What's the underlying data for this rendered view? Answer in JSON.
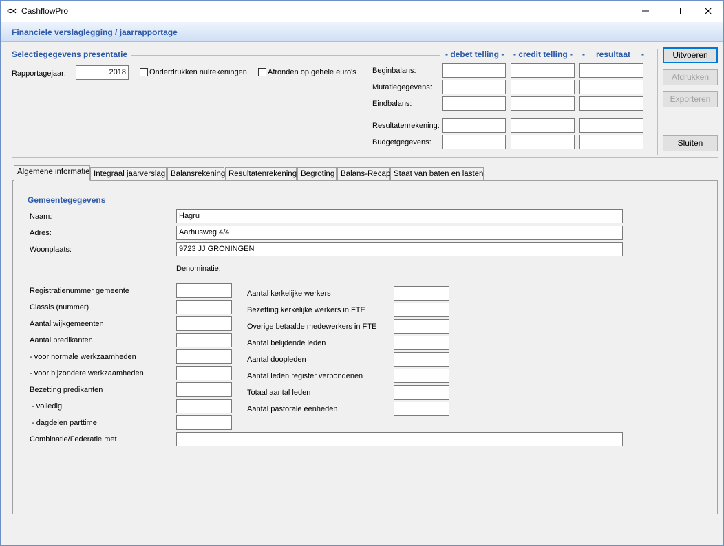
{
  "window": {
    "title": "CashflowPro"
  },
  "header": {
    "title": "Financiele verslaglegging / jaarrapportage"
  },
  "selection": {
    "title": "Selectiegegevens presentatie",
    "year_label": "Rapportagejaar:",
    "year_value": "2018",
    "suppress_label": "Onderdrukken nulrekeningen",
    "suppress_checked": false,
    "round_label": "Afronden op gehele euro's",
    "round_checked": false
  },
  "columns": {
    "debet": "- debet telling -",
    "credit": "- credit telling -",
    "dash": "-",
    "result": "resultaat",
    "dash2": "-"
  },
  "balance_rows": [
    {
      "label": "Beginbalans:",
      "debet": "",
      "credit": "",
      "result": ""
    },
    {
      "label": "Mutatiegegevens:",
      "debet": "",
      "credit": "",
      "result": ""
    },
    {
      "label": "Eindbalans:",
      "debet": "",
      "credit": "",
      "result": ""
    },
    {
      "label": "Resultatenrekening:",
      "debet": "",
      "credit": "",
      "result": ""
    },
    {
      "label": "Budgetgegevens:",
      "debet": "",
      "credit": "",
      "result": ""
    }
  ],
  "buttons": {
    "execute": "Uitvoeren",
    "print": "Afdrukken",
    "export": "Exporteren",
    "close": "Sluiten"
  },
  "tabs": [
    "Algemene informatie",
    "Integraal jaarverslag",
    "Balansrekening",
    "Resultatenrekening",
    "Begroting",
    "Balans-Recap",
    "Staat van baten en lasten"
  ],
  "active_tab": "Algemene informatie",
  "gemeente": {
    "heading": "Gemeentegegevens",
    "name_label": "Naam:",
    "name_value": "Hagru",
    "address_label": "Adres:",
    "address_value": "Aarhusweg 4/4",
    "city_label": "Woonplaats:",
    "city_value": "9723 JJ GRONINGEN",
    "denomination_label": "Denominatie:"
  },
  "left_fields": [
    {
      "label": "Registratienummer gemeente",
      "value": ""
    },
    {
      "label": "Classis (nummer)",
      "value": ""
    },
    {
      "label": "Aantal wijkgemeenten",
      "value": ""
    },
    {
      "label": "Aantal predikanten",
      "value": ""
    },
    {
      "label": "- voor normale werkzaamheden",
      "value": ""
    },
    {
      "label": "- voor bijzondere werkzaamheden",
      "value": ""
    },
    {
      "label": "Bezetting predikanten",
      "value": ""
    },
    {
      "label": " - volledig",
      "value": ""
    },
    {
      "label": " - dagdelen parttime",
      "value": ""
    }
  ],
  "right_fields": [
    {
      "label": "Aantal kerkelijke werkers",
      "value": ""
    },
    {
      "label": "Bezetting kerkelijke werkers in FTE",
      "value": ""
    },
    {
      "label": "Overige betaalde medewerkers in FTE",
      "value": ""
    },
    {
      "label": "Aantal belijdende leden",
      "value": ""
    },
    {
      "label": "Aantal doopleden",
      "value": ""
    },
    {
      "label": "Aantal leden register verbondenen",
      "value": ""
    },
    {
      "label": "Totaal aantal leden",
      "value": ""
    },
    {
      "label": "Aantal pastorale eenheden",
      "value": ""
    }
  ],
  "combination": {
    "label": "Combinatie/Federatie met",
    "value": ""
  },
  "colors": {
    "accent": "#2d5aa8",
    "header_band": "#dce8f8",
    "window_bg": "#f0f0f0"
  },
  "icons": {
    "app": "fish-icon",
    "minimize": "minimize-icon",
    "maximize": "maximize-icon",
    "close": "close-icon"
  }
}
